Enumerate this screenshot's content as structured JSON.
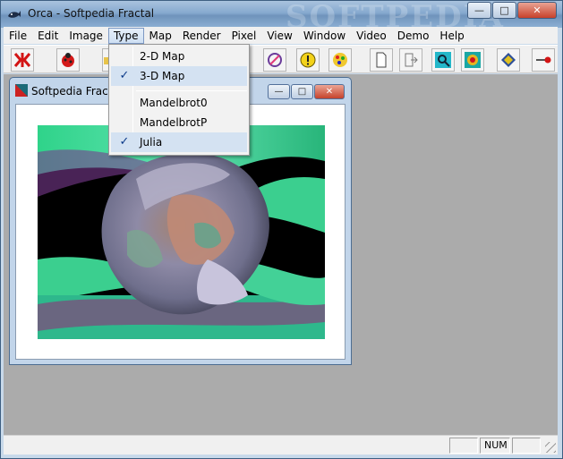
{
  "window": {
    "title": "Orca - Softpedia Fractal",
    "watermark": "SOFTPEDIA",
    "controls": {
      "minimize": "—",
      "maximize": "□",
      "close": "✕"
    }
  },
  "menubar": {
    "items": [
      {
        "label": "File"
      },
      {
        "label": "Edit"
      },
      {
        "label": "Image"
      },
      {
        "label": "Type",
        "active": true
      },
      {
        "label": "Map"
      },
      {
        "label": "Render"
      },
      {
        "label": "Pixel"
      },
      {
        "label": "View"
      },
      {
        "label": "Window"
      },
      {
        "label": "Video"
      },
      {
        "label": "Demo"
      },
      {
        "label": "Help"
      }
    ]
  },
  "type_menu": {
    "items": [
      {
        "label": "2-D Map",
        "checked": false
      },
      {
        "label": "3-D Map",
        "checked": true
      },
      {
        "label": "Mandelbrot0",
        "checked": false
      },
      {
        "label": "MandelbrotP",
        "checked": false
      },
      {
        "label": "Julia",
        "checked": true
      }
    ],
    "check_glyph": "✓"
  },
  "toolbar": {
    "icons": [
      "fractal-red-icon",
      "ladybug-icon",
      "folder-icon",
      "pen-icon",
      "alert-icon",
      "palette-icon",
      "new-document-icon",
      "exit-door-icon",
      "zoom-icon",
      "color-wheel-icon",
      "diamond-icon",
      "pointer-icon"
    ]
  },
  "child_window": {
    "title": "Softpedia Fractal",
    "controls": {
      "minimize": "—",
      "maximize": "□",
      "close": "✕"
    }
  },
  "statusbar": {
    "cells": [
      "",
      "NUM",
      ""
    ]
  }
}
